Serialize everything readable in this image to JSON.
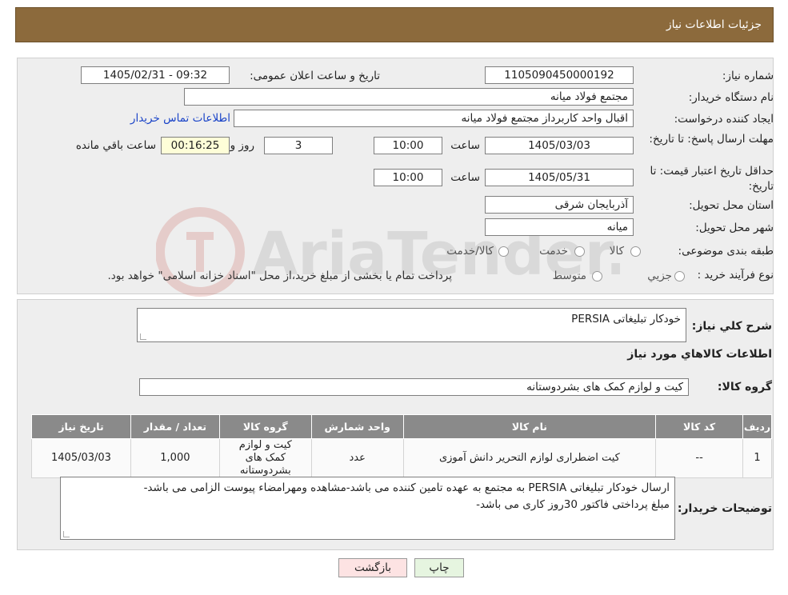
{
  "header": {
    "title": "جزئیات اطلاعات نیاز"
  },
  "info": {
    "need_number_label": "شماره نیاز:",
    "need_number": "1105090450000192",
    "announce_label": "تاریخ و ساعت اعلان عمومی:",
    "announce_value": "1405/02/31 - 09:32",
    "buyer_label": "نام دستگاه خریدار:",
    "buyer_value": "مجتمع فولاد میانه",
    "creator_label": "ایجاد کننده درخواست:",
    "creator_value": "اقبال واحد کاربرداز مجتمع فولاد میانه",
    "contact_link": "اطلاعات تماس خریدار",
    "deadline_label": "مهلت ارسال پاسخ: تا تاریخ:",
    "deadline_date": "1405/03/03",
    "time_label": "ساعت",
    "deadline_time": "10:00",
    "days_value": "3",
    "days_label": "روز و",
    "remaining_value": "00:16:25",
    "remaining_label": "ساعت باقي مانده",
    "validity_label": "حداقل تاریخ اعتبار قیمت: تا تاریخ:",
    "validity_date": "1405/05/31",
    "validity_time": "10:00",
    "province_label": "استان محل تحویل:",
    "province_value": "آذربایجان شرقی",
    "city_label": "شهر محل تحویل:",
    "city_value": "میانه",
    "category_label": "طبقه بندی موضوعی:",
    "category_options": [
      "کالا",
      "خدمت",
      "کالا/خدمت"
    ],
    "process_label": "نوع فرآیند خرید :",
    "process_options": [
      "جزیي",
      "متوسط"
    ],
    "process_note": "پرداخت تمام یا بخشی از مبلغ خرید،از محل \"اسناد خزانه اسلامی\" خواهد بود."
  },
  "summary": {
    "desc_label": "شرح كلي نياز:",
    "desc_value": "خودکار تبلیغاتی PERSIA",
    "goods_info_title": "اطلاعات كالاهاي مورد نياز",
    "group_label": "گروه كالا:",
    "group_value": "کیت و لوازم کمک های بشردوستانه"
  },
  "table": {
    "headers": [
      "رديف",
      "كد كالا",
      "نام كالا",
      "واحد شمارش",
      "گروه كالا",
      "تعداد / مقدار",
      "تاريخ نياز"
    ],
    "rows": [
      [
        "1",
        "--",
        "کیت اضطراری لوازم التحریر دانش آموزی",
        "عدد",
        "کیت و لوازم کمک های بشردوستانه",
        "1,000",
        "1405/03/03"
      ]
    ]
  },
  "notes": {
    "label": "توضیحات خریدار:",
    "line1": "ارسال خودکار تبلیغاتی PERSIA  به مجتمع به عهده تامین کننده می باشد-مشاهده ومهرامضاء پیوست الزامی می باشد-",
    "line2": "مبلغ پرداختی فاکتور 30روز کاری می باشد-"
  },
  "buttons": {
    "print": "چاپ",
    "back": "بازگشت"
  },
  "watermark": {
    "text": "AriaTender.neT"
  },
  "colors": {
    "header_bg": "#8c6a3c",
    "table_header_bg": "#8a8a8a",
    "link": "#1a44c8",
    "back_btn_bg": "#fde3e3",
    "print_btn_bg": "#e6f5e0"
  }
}
